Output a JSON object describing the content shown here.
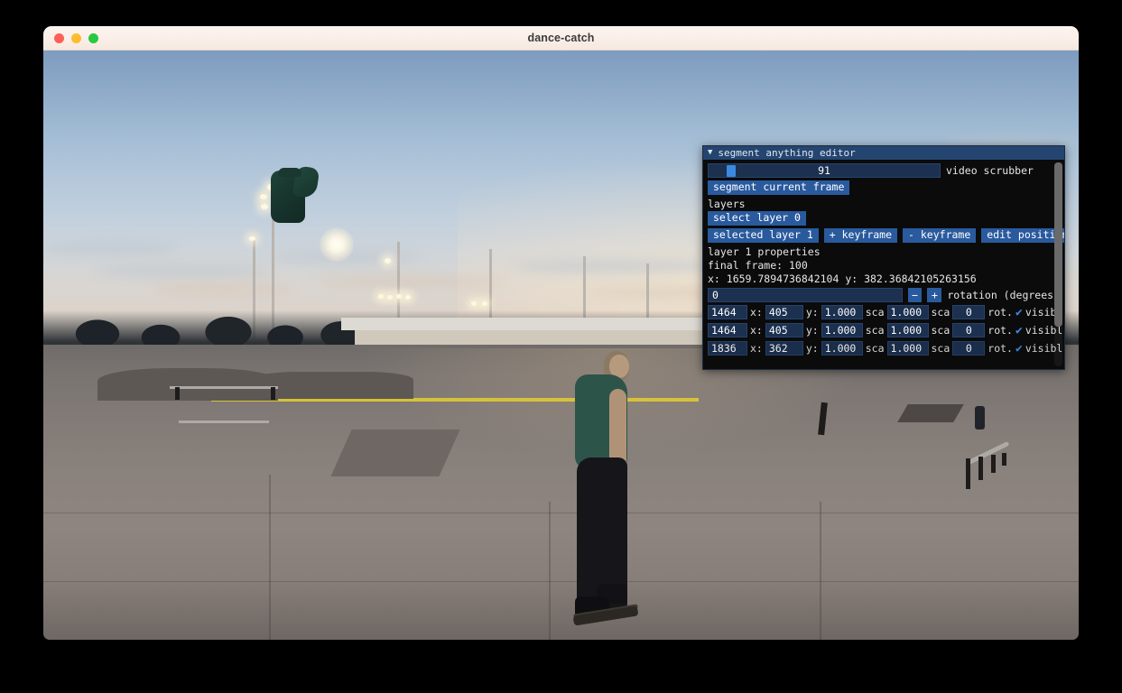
{
  "window": {
    "title": "dance-catch",
    "traffic_lights": [
      {
        "name": "close",
        "color": "#ff5f57"
      },
      {
        "name": "minimize",
        "color": "#febc2e"
      },
      {
        "name": "maximize",
        "color": "#28c840"
      }
    ]
  },
  "editor": {
    "panel_title": "segment anything editor",
    "collapse_icon": "▼",
    "scrubber": {
      "value": "91",
      "label": "video scrubber",
      "min": 0,
      "max": 100,
      "handle_percent": 8
    },
    "segment_button": "segment current frame",
    "layers_label": "layers",
    "select_layer_button": "select layer 0",
    "selected_layer_button": "selected layer 1",
    "add_keyframe_button": "+ keyframe",
    "remove_keyframe_button": "- keyframe",
    "edit_position_button": "edit position",
    "layer_properties_heading": "layer 1 properties",
    "final_frame_text": "final frame: 100",
    "position_text": "x: 1659.7894736842104 y: 382.36842105263156",
    "rotation": {
      "value": "0",
      "minus_label": "−",
      "plus_label": "+",
      "label": "rotation (degrees)"
    },
    "keyframe_columns": {
      "x_label": "x:",
      "y_label": "y:",
      "scale_label": "sca",
      "rotation_label": "rot.",
      "visible_label": "visibl",
      "check_glyph": "✔"
    },
    "keyframes": [
      {
        "frame": "1464",
        "x": "405",
        "y": "1.000",
        "scale_x": "1.000",
        "scale_y": "1.000",
        "rotation": "0",
        "visible": true
      },
      {
        "frame": "1464",
        "x": "405",
        "y": "1.000",
        "scale_x": "1.000",
        "scale_y": "1.000",
        "rotation": "0",
        "visible": true
      },
      {
        "frame": "1836",
        "x": "362",
        "y": "1.000",
        "scale_x": "1.000",
        "scale_y": "1.000",
        "rotation": "0",
        "visible": true
      }
    ],
    "colors": {
      "panel_background": "#0b0b0b",
      "titlebar": "#24456f",
      "accent": "#2a5a9e",
      "field": "#1c3050",
      "highlight": "#3b8ae0",
      "text": "#e8e8e8"
    }
  },
  "scene": {
    "description": "skatepark at dusk with skateboarder",
    "floating_layer": "segmented teal t-shirt",
    "colors": {
      "sky_top": "#7e9cc0",
      "sky_bottom": "#d6cdc4",
      "ground": "#8a827d",
      "shirt": "#1f4439",
      "tape": "#d6c23a"
    }
  }
}
